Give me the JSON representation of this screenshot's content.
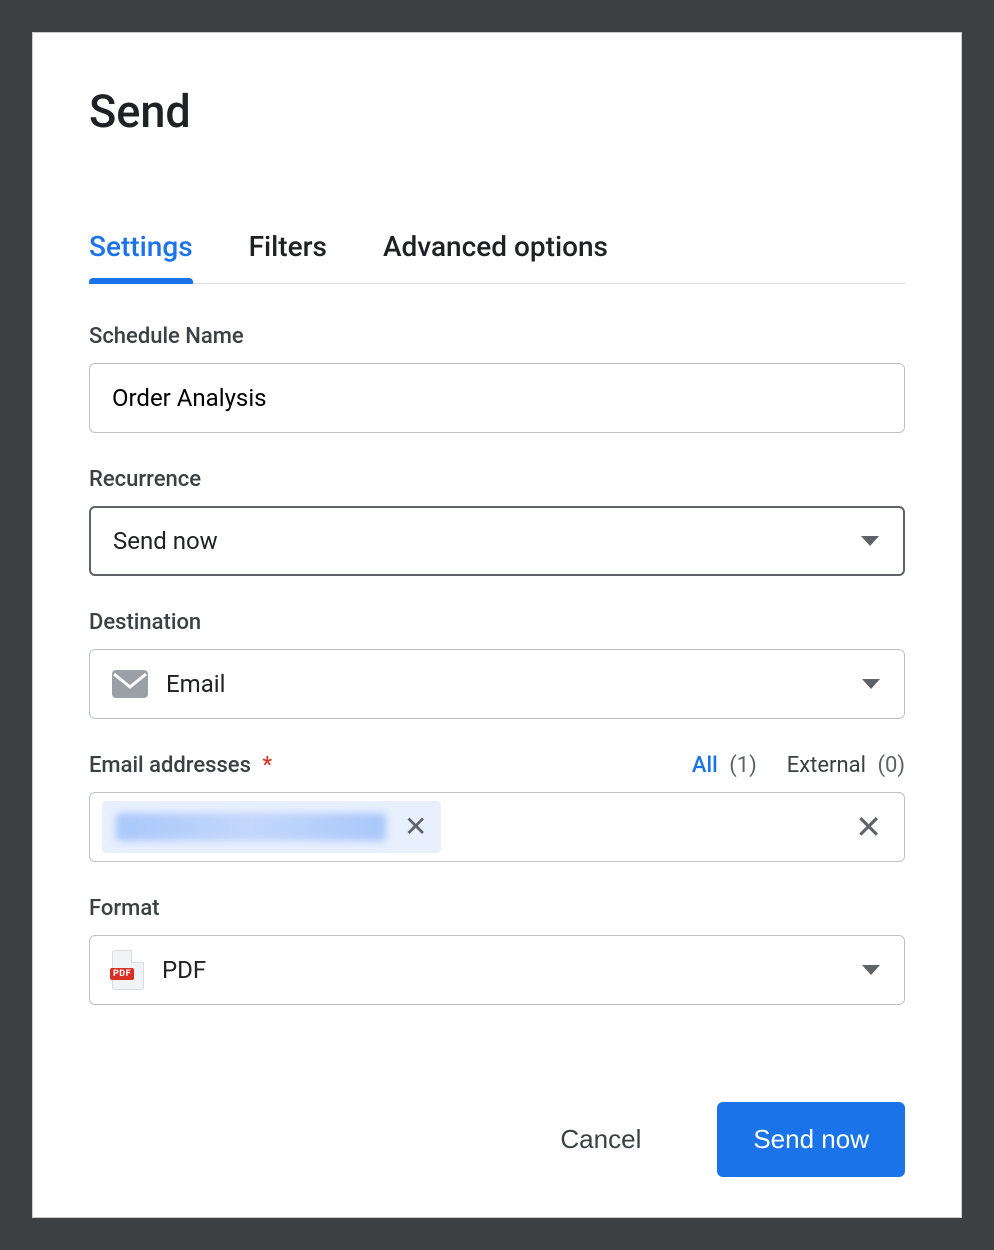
{
  "dialog": {
    "title": "Send",
    "tabs": [
      {
        "label": "Settings",
        "active": true
      },
      {
        "label": "Filters",
        "active": false
      },
      {
        "label": "Advanced options",
        "active": false
      }
    ],
    "schedule_name": {
      "label": "Schedule Name",
      "value": "Order Analysis"
    },
    "recurrence": {
      "label": "Recurrence",
      "value": "Send now"
    },
    "destination": {
      "label": "Destination",
      "value": "Email",
      "icon": "email-icon"
    },
    "email_addresses": {
      "label": "Email addresses",
      "required": true,
      "all_label": "All",
      "all_count": "(1)",
      "external_label": "External",
      "external_count": "(0)",
      "chips": [
        {
          "text_redacted": true
        }
      ]
    },
    "format": {
      "label": "Format",
      "value": "PDF",
      "icon": "pdf-icon",
      "badge": "PDF"
    },
    "footer": {
      "cancel": "Cancel",
      "submit": "Send now"
    }
  }
}
